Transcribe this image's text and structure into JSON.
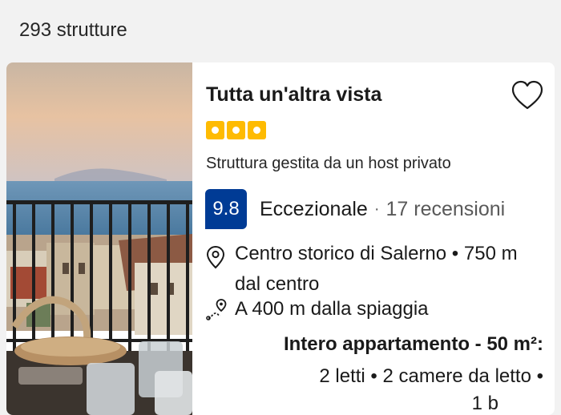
{
  "results": {
    "count_text": "293 strutture"
  },
  "property": {
    "name": "Tutta un'altra vista",
    "star_count": 3,
    "host_note": "Struttura gestita da un host privato",
    "score": "9.8",
    "rating_word": "Eccezionale",
    "separator": "·",
    "reviews_text": "17 recensioni",
    "location_text": "Centro storico di Salerno • 750 m dal centro",
    "beach_text": "A 400 m dalla spiaggia",
    "unit_type": "Intero appartamento - 50 m²:",
    "beds_text": "2 letti • 2 camere da letto •",
    "cut_off_text": "1 b"
  },
  "icons": {
    "favorite": "heart-outline-icon",
    "location": "map-pin-icon",
    "beach": "route-distance-icon",
    "stars": "rating-square-icon"
  },
  "colors": {
    "score_badge": "#003b95",
    "star": "#febb02",
    "background": "#f2f2f2"
  }
}
